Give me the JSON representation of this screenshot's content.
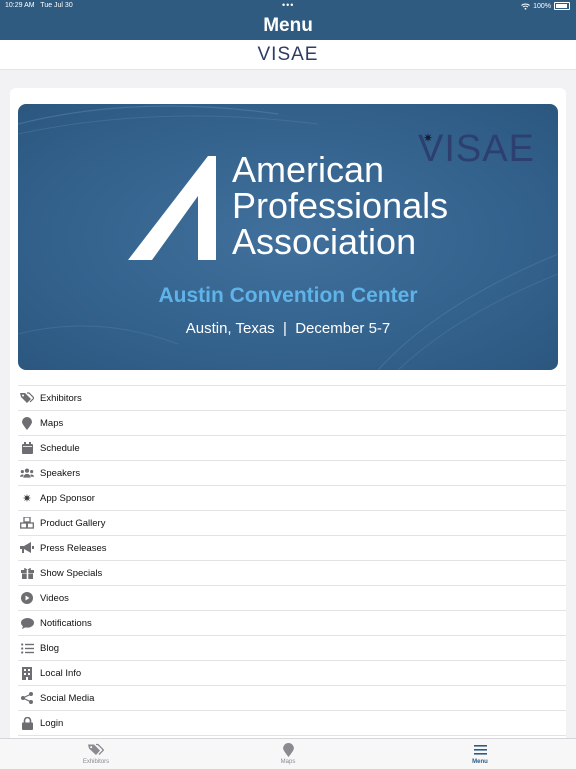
{
  "status": {
    "time": "10:29 AM",
    "date": "Tue Jul 30",
    "battery": "100%"
  },
  "nav": {
    "title": "Menu"
  },
  "brand": {
    "logo": "VISAE"
  },
  "banner": {
    "logo": "VISAE",
    "name_lines": [
      "American",
      "Professionals",
      "Association"
    ],
    "venue": "Austin Convention Center",
    "details": "Austin, Texas  |  December 5-7",
    "colors": {
      "background": "#33628d",
      "venue": "#5fb3e8"
    }
  },
  "menu": {
    "items": [
      {
        "label": "Exhibitors",
        "icon": "tags-icon"
      },
      {
        "label": "Maps",
        "icon": "map-pin-icon"
      },
      {
        "label": "Schedule",
        "icon": "calendar-icon"
      },
      {
        "label": "Speakers",
        "icon": "users-icon"
      },
      {
        "label": "App Sponsor",
        "icon": "star-burst-icon"
      },
      {
        "label": "Product Gallery",
        "icon": "cubes-icon"
      },
      {
        "label": "Press Releases",
        "icon": "megaphone-icon"
      },
      {
        "label": "Show Specials",
        "icon": "gift-icon"
      },
      {
        "label": "Videos",
        "icon": "play-circle-icon"
      },
      {
        "label": "Notifications",
        "icon": "chat-bubble-icon"
      },
      {
        "label": "Blog",
        "icon": "list-icon"
      },
      {
        "label": "Local Info",
        "icon": "building-icon"
      },
      {
        "label": "Social Media",
        "icon": "share-icon"
      },
      {
        "label": "Login",
        "icon": "lock-icon"
      }
    ]
  },
  "tabs": [
    {
      "label": "Exhibitors",
      "icon": "tags-icon",
      "active": false
    },
    {
      "label": "Maps",
      "icon": "map-pin-icon",
      "active": false
    },
    {
      "label": "Menu",
      "icon": "menu-icon",
      "active": true
    }
  ],
  "colors": {
    "accent": "#2f5b80",
    "icon": "#6d6d72"
  }
}
